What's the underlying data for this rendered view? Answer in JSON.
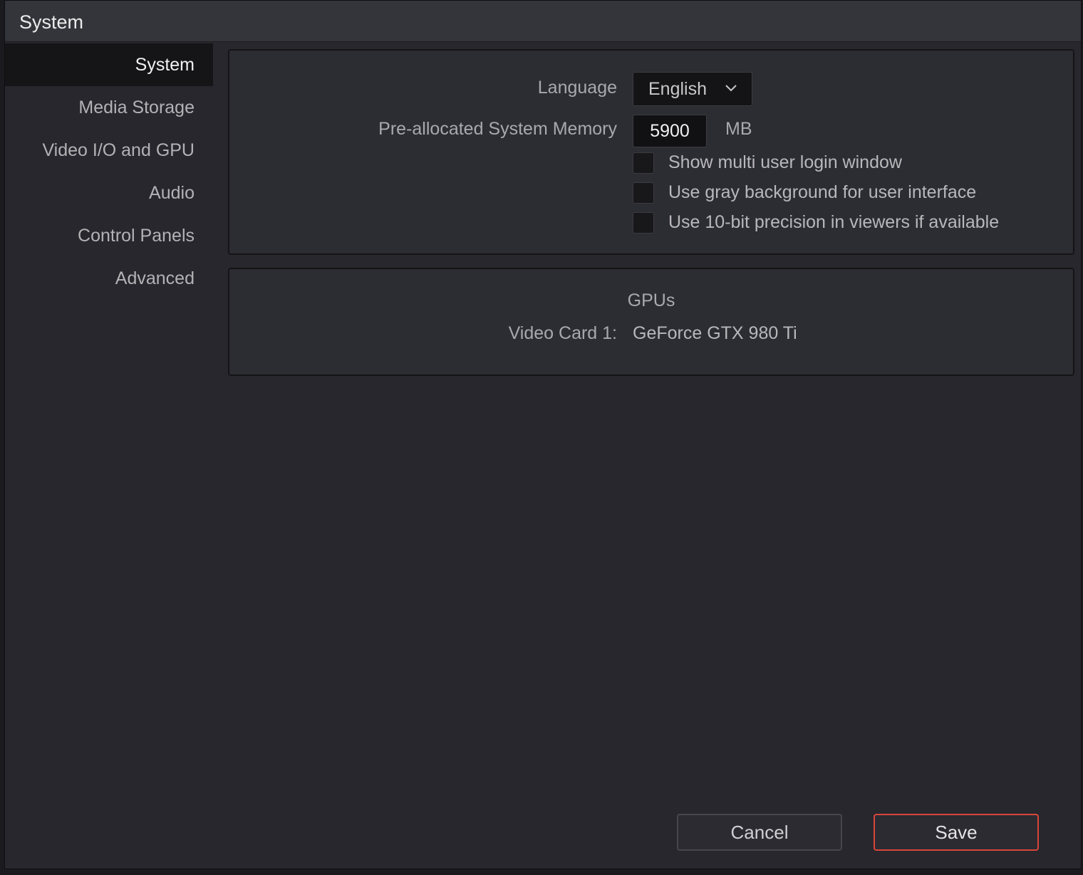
{
  "window": {
    "title": "System"
  },
  "sidebar": {
    "items": [
      {
        "label": "System",
        "active": true
      },
      {
        "label": "Media Storage"
      },
      {
        "label": "Video I/O and GPU"
      },
      {
        "label": "Audio"
      },
      {
        "label": "Control Panels"
      },
      {
        "label": "Advanced"
      }
    ]
  },
  "system_panel": {
    "language_label": "Language",
    "language_value": "English",
    "memory_label": "Pre-allocated System Memory",
    "memory_value": "5900",
    "memory_unit": "MB",
    "checkboxes": [
      {
        "label": "Show multi user login window",
        "checked": false
      },
      {
        "label": "Use gray background for user interface",
        "checked": false
      },
      {
        "label": "Use 10-bit precision in viewers if available",
        "checked": false
      }
    ]
  },
  "gpu_panel": {
    "heading": "GPUs",
    "card_label": "Video Card 1:",
    "card_value": "GeForce GTX 980 Ti"
  },
  "buttons": {
    "cancel": "Cancel",
    "save": "Save"
  },
  "colors": {
    "save_accent": "#d8463b",
    "background": "#27272d",
    "active_nav": "#151518"
  },
  "icons": {
    "dropdown": "chevron-down-icon"
  }
}
